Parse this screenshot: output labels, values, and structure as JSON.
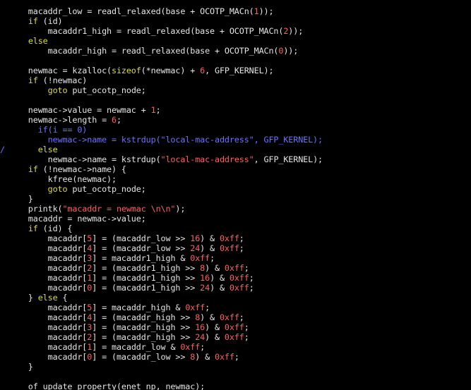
{
  "colors": {
    "background": "#000000",
    "plain": "#e4e4e4",
    "keyword": "#d8d84a",
    "number": "#ff5f5f",
    "string": "#ff5f5f",
    "disabled": "#7070ff",
    "gutter_mark": "#7070ff"
  },
  "editor": {
    "lines": [
      {
        "gutter": "",
        "tokens": [
          {
            "t": "    macaddr_low = readl_relaxed(base + OCOTP_MACn(",
            "c": "plain"
          },
          {
            "t": "1",
            "c": "number"
          },
          {
            "t": "));",
            "c": "plain"
          }
        ]
      },
      {
        "gutter": "",
        "tokens": [
          {
            "t": "    ",
            "c": "plain"
          },
          {
            "t": "if",
            "c": "keyword"
          },
          {
            "t": " (id)",
            "c": "plain"
          }
        ]
      },
      {
        "gutter": "",
        "tokens": [
          {
            "t": "        macaddr1_high = readl_relaxed(base + OCOTP_MACn(",
            "c": "plain"
          },
          {
            "t": "2",
            "c": "number"
          },
          {
            "t": "));",
            "c": "plain"
          }
        ]
      },
      {
        "gutter": "",
        "tokens": [
          {
            "t": "    ",
            "c": "plain"
          },
          {
            "t": "else",
            "c": "keyword"
          }
        ]
      },
      {
        "gutter": "",
        "tokens": [
          {
            "t": "        macaddr_high = readl_relaxed(base + OCOTP_MACn(",
            "c": "plain"
          },
          {
            "t": "0",
            "c": "number"
          },
          {
            "t": "));",
            "c": "plain"
          }
        ]
      },
      {
        "gutter": "",
        "tokens": [
          {
            "t": "",
            "c": "plain"
          }
        ]
      },
      {
        "gutter": "",
        "tokens": [
          {
            "t": "    newmac = kzalloc(",
            "c": "plain"
          },
          {
            "t": "sizeof",
            "c": "keyword"
          },
          {
            "t": "(*newmac) + ",
            "c": "plain"
          },
          {
            "t": "6",
            "c": "number"
          },
          {
            "t": ", GFP_KERNEL);",
            "c": "plain"
          }
        ]
      },
      {
        "gutter": "",
        "tokens": [
          {
            "t": "    ",
            "c": "plain"
          },
          {
            "t": "if",
            "c": "keyword"
          },
          {
            "t": " (!newmac)",
            "c": "plain"
          }
        ]
      },
      {
        "gutter": "",
        "tokens": [
          {
            "t": "        ",
            "c": "plain"
          },
          {
            "t": "goto",
            "c": "keyword"
          },
          {
            "t": " put_ocotp_node;",
            "c": "plain"
          }
        ]
      },
      {
        "gutter": "",
        "tokens": [
          {
            "t": "",
            "c": "plain"
          }
        ]
      },
      {
        "gutter": "",
        "tokens": [
          {
            "t": "    newmac->value = newmac + ",
            "c": "plain"
          },
          {
            "t": "1",
            "c": "number"
          },
          {
            "t": ";",
            "c": "plain"
          }
        ]
      },
      {
        "gutter": "",
        "tokens": [
          {
            "t": "    newmac->length = ",
            "c": "plain"
          },
          {
            "t": "6",
            "c": "number"
          },
          {
            "t": ";",
            "c": "plain"
          }
        ]
      },
      {
        "gutter": "",
        "tokens": [
          {
            "t": "      if(i == 0)",
            "c": "disabled"
          }
        ]
      },
      {
        "gutter": "",
        "tokens": [
          {
            "t": "        newmac->name = kstrdup(\"local-mac-address\", GFP_KERNEL);",
            "c": "disabled"
          }
        ]
      },
      {
        "gutter": "/",
        "tokens": [
          {
            "t": "      ",
            "c": "plain"
          },
          {
            "t": "else",
            "c": "keyword"
          }
        ]
      },
      {
        "gutter": "",
        "tokens": [
          {
            "t": "        newmac->name = kstrdup(",
            "c": "plain"
          },
          {
            "t": "\"local-mac-address\"",
            "c": "string"
          },
          {
            "t": ", GFP_KERNEL);",
            "c": "plain"
          }
        ]
      },
      {
        "gutter": "",
        "tokens": [
          {
            "t": "    ",
            "c": "plain"
          },
          {
            "t": "if",
            "c": "keyword"
          },
          {
            "t": " (!newmac->name) {",
            "c": "plain"
          }
        ]
      },
      {
        "gutter": "",
        "tokens": [
          {
            "t": "        kfree(newmac);",
            "c": "plain"
          }
        ]
      },
      {
        "gutter": "",
        "tokens": [
          {
            "t": "        ",
            "c": "plain"
          },
          {
            "t": "goto",
            "c": "keyword"
          },
          {
            "t": " put_ocotp_node;",
            "c": "plain"
          }
        ]
      },
      {
        "gutter": "",
        "tokens": [
          {
            "t": "    }",
            "c": "plain"
          }
        ]
      },
      {
        "gutter": "",
        "tokens": [
          {
            "t": "    printk(",
            "c": "plain"
          },
          {
            "t": "\"macaddr = newmac \\n\\n\"",
            "c": "string"
          },
          {
            "t": ");",
            "c": "plain"
          }
        ]
      },
      {
        "gutter": "",
        "tokens": [
          {
            "t": "    macaddr = newmac->value;",
            "c": "plain"
          }
        ]
      },
      {
        "gutter": "",
        "tokens": [
          {
            "t": "    ",
            "c": "plain"
          },
          {
            "t": "if",
            "c": "keyword"
          },
          {
            "t": " (id) {",
            "c": "plain"
          }
        ]
      },
      {
        "gutter": "",
        "tokens": [
          {
            "t": "        macaddr[",
            "c": "plain"
          },
          {
            "t": "5",
            "c": "number"
          },
          {
            "t": "] = (macaddr_low >> ",
            "c": "plain"
          },
          {
            "t": "16",
            "c": "number"
          },
          {
            "t": ") & ",
            "c": "plain"
          },
          {
            "t": "0xff",
            "c": "number"
          },
          {
            "t": ";",
            "c": "plain"
          }
        ]
      },
      {
        "gutter": "",
        "tokens": [
          {
            "t": "        macaddr[",
            "c": "plain"
          },
          {
            "t": "4",
            "c": "number"
          },
          {
            "t": "] = (macaddr_low >> ",
            "c": "plain"
          },
          {
            "t": "24",
            "c": "number"
          },
          {
            "t": ") & ",
            "c": "plain"
          },
          {
            "t": "0xff",
            "c": "number"
          },
          {
            "t": ";",
            "c": "plain"
          }
        ]
      },
      {
        "gutter": "",
        "tokens": [
          {
            "t": "        macaddr[",
            "c": "plain"
          },
          {
            "t": "3",
            "c": "number"
          },
          {
            "t": "] = macaddr1_high & ",
            "c": "plain"
          },
          {
            "t": "0xff",
            "c": "number"
          },
          {
            "t": ";",
            "c": "plain"
          }
        ]
      },
      {
        "gutter": "",
        "tokens": [
          {
            "t": "        macaddr[",
            "c": "plain"
          },
          {
            "t": "2",
            "c": "number"
          },
          {
            "t": "] = (macaddr1_high >> ",
            "c": "plain"
          },
          {
            "t": "8",
            "c": "number"
          },
          {
            "t": ") & ",
            "c": "plain"
          },
          {
            "t": "0xff",
            "c": "number"
          },
          {
            "t": ";",
            "c": "plain"
          }
        ]
      },
      {
        "gutter": "",
        "tokens": [
          {
            "t": "        macaddr[",
            "c": "plain"
          },
          {
            "t": "1",
            "c": "number"
          },
          {
            "t": "] = (macaddr1_high >> ",
            "c": "plain"
          },
          {
            "t": "16",
            "c": "number"
          },
          {
            "t": ") & ",
            "c": "plain"
          },
          {
            "t": "0xff",
            "c": "number"
          },
          {
            "t": ";",
            "c": "plain"
          }
        ]
      },
      {
        "gutter": "",
        "tokens": [
          {
            "t": "        macaddr[",
            "c": "plain"
          },
          {
            "t": "0",
            "c": "number"
          },
          {
            "t": "] = (macaddr1_high >> ",
            "c": "plain"
          },
          {
            "t": "24",
            "c": "number"
          },
          {
            "t": ") & ",
            "c": "plain"
          },
          {
            "t": "0xff",
            "c": "number"
          },
          {
            "t": ";",
            "c": "plain"
          }
        ]
      },
      {
        "gutter": "",
        "tokens": [
          {
            "t": "    } ",
            "c": "plain"
          },
          {
            "t": "else",
            "c": "keyword"
          },
          {
            "t": " {",
            "c": "plain"
          }
        ]
      },
      {
        "gutter": "",
        "tokens": [
          {
            "t": "        macaddr[",
            "c": "plain"
          },
          {
            "t": "5",
            "c": "number"
          },
          {
            "t": "] = macaddr_high & ",
            "c": "plain"
          },
          {
            "t": "0xff",
            "c": "number"
          },
          {
            "t": ";",
            "c": "plain"
          }
        ]
      },
      {
        "gutter": "",
        "tokens": [
          {
            "t": "        macaddr[",
            "c": "plain"
          },
          {
            "t": "4",
            "c": "number"
          },
          {
            "t": "] = (macaddr_high >> ",
            "c": "plain"
          },
          {
            "t": "8",
            "c": "number"
          },
          {
            "t": ") & ",
            "c": "plain"
          },
          {
            "t": "0xff",
            "c": "number"
          },
          {
            "t": ";",
            "c": "plain"
          }
        ]
      },
      {
        "gutter": "",
        "tokens": [
          {
            "t": "        macaddr[",
            "c": "plain"
          },
          {
            "t": "3",
            "c": "number"
          },
          {
            "t": "] = (macaddr_high >> ",
            "c": "plain"
          },
          {
            "t": "16",
            "c": "number"
          },
          {
            "t": ") & ",
            "c": "plain"
          },
          {
            "t": "0xff",
            "c": "number"
          },
          {
            "t": ";",
            "c": "plain"
          }
        ]
      },
      {
        "gutter": "",
        "tokens": [
          {
            "t": "        macaddr[",
            "c": "plain"
          },
          {
            "t": "2",
            "c": "number"
          },
          {
            "t": "] = (macaddr_high >> ",
            "c": "plain"
          },
          {
            "t": "24",
            "c": "number"
          },
          {
            "t": ") & ",
            "c": "plain"
          },
          {
            "t": "0xff",
            "c": "number"
          },
          {
            "t": ";",
            "c": "plain"
          }
        ]
      },
      {
        "gutter": "",
        "tokens": [
          {
            "t": "        macaddr[",
            "c": "plain"
          },
          {
            "t": "1",
            "c": "number"
          },
          {
            "t": "] = macaddr_low & ",
            "c": "plain"
          },
          {
            "t": "0xff",
            "c": "number"
          },
          {
            "t": ";",
            "c": "plain"
          }
        ]
      },
      {
        "gutter": "",
        "tokens": [
          {
            "t": "        macaddr[",
            "c": "plain"
          },
          {
            "t": "0",
            "c": "number"
          },
          {
            "t": "] = (macaddr_low >> ",
            "c": "plain"
          },
          {
            "t": "8",
            "c": "number"
          },
          {
            "t": ") & ",
            "c": "plain"
          },
          {
            "t": "0xff",
            "c": "number"
          },
          {
            "t": ";",
            "c": "plain"
          }
        ]
      },
      {
        "gutter": "",
        "tokens": [
          {
            "t": "    }",
            "c": "plain"
          }
        ]
      },
      {
        "gutter": "",
        "tokens": [
          {
            "t": "",
            "c": "plain"
          }
        ]
      },
      {
        "gutter": "",
        "tokens": [
          {
            "t": "    of_update_property(enet_np, newmac);",
            "c": "plain"
          }
        ]
      }
    ]
  }
}
